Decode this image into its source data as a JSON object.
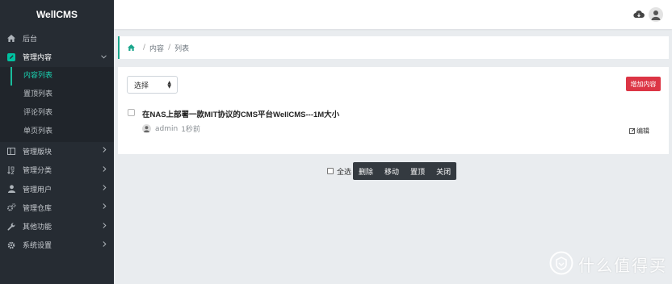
{
  "app": {
    "brand": "WellCMS"
  },
  "sidebar": {
    "items": [
      {
        "label": "后台",
        "icon": "home-icon"
      },
      {
        "label": "管理内容",
        "icon": "edit-square-icon",
        "active": true,
        "children": [
          {
            "label": "内容列表",
            "current": true
          },
          {
            "label": "置顶列表"
          },
          {
            "label": "评论列表"
          },
          {
            "label": "单页列表"
          }
        ]
      },
      {
        "label": "管理版块",
        "icon": "columns-icon"
      },
      {
        "label": "管理分类",
        "icon": "sort-icon"
      },
      {
        "label": "管理用户",
        "icon": "user-icon"
      },
      {
        "label": "管理仓库",
        "icon": "cogs-icon"
      },
      {
        "label": "其他功能",
        "icon": "wrench-icon"
      },
      {
        "label": "系统设置",
        "icon": "gear-icon"
      }
    ]
  },
  "breadcrumb": {
    "items": [
      "内容",
      "列表"
    ],
    "separator": "/"
  },
  "toolbar": {
    "select_value": "选择",
    "add_label": "增加内容"
  },
  "list": {
    "rows": [
      {
        "title": "在NAS上部署一款MIT协议的CMS平台WellCMS---1M大小",
        "author": "admin",
        "time": "1秒前",
        "edit_label": "编辑"
      }
    ]
  },
  "bulk": {
    "select_all_label": "全选",
    "buttons": [
      "删除",
      "移动",
      "置顶",
      "关闭"
    ]
  },
  "watermark": {
    "text": "什么值得买"
  },
  "colors": {
    "sidebar_bg": "#262c33",
    "accent": "#1aa68c",
    "danger": "#dc3545",
    "dark_btn": "#343a40"
  }
}
